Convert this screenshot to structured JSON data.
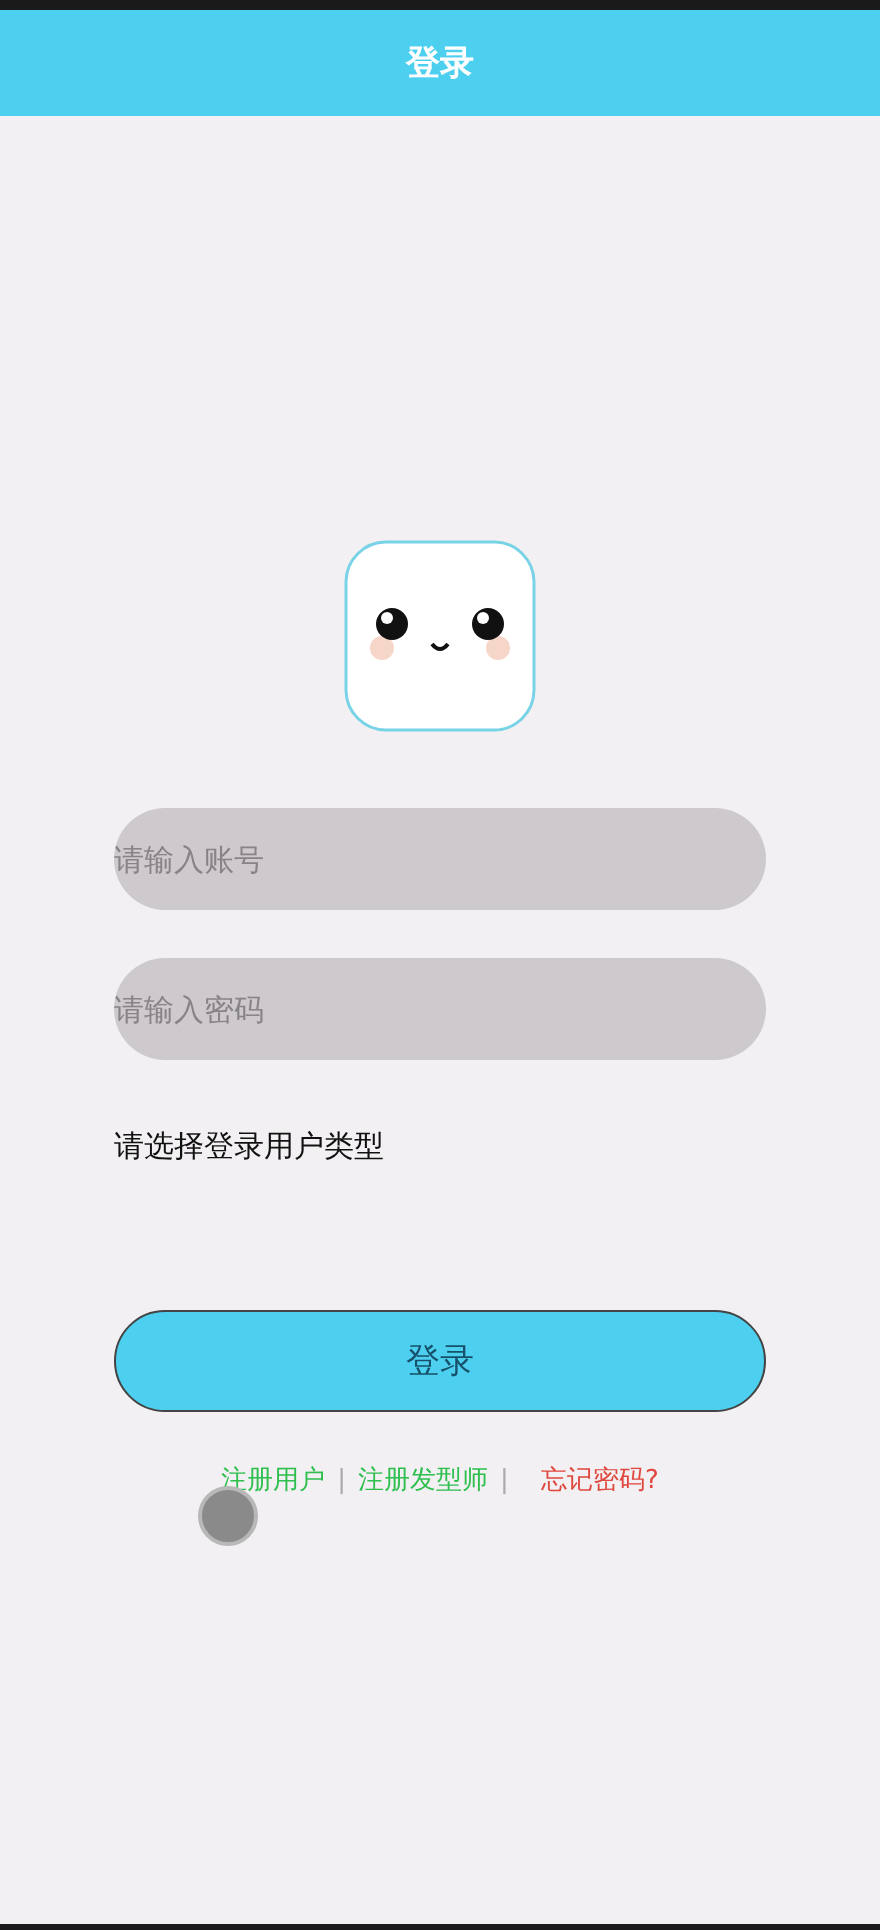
{
  "header": {
    "title": "登录"
  },
  "account_field": {
    "placeholder": "请输入账号"
  },
  "password_field": {
    "placeholder": "请输入密码"
  },
  "user_type_label": "请选择登录用户类型",
  "login_button": "登录",
  "footer_links": [
    {
      "kind": "link",
      "text": "注册用户",
      "color": "#2fbf4f"
    },
    {
      "kind": "separator",
      "text": "|"
    },
    {
      "kind": "link",
      "text": "注册发型师",
      "color": "#2fbf4f"
    },
    {
      "kind": "separator",
      "text": "|"
    },
    {
      "kind": "link",
      "text": "忘记密码?",
      "color": "#e0483f"
    }
  ]
}
